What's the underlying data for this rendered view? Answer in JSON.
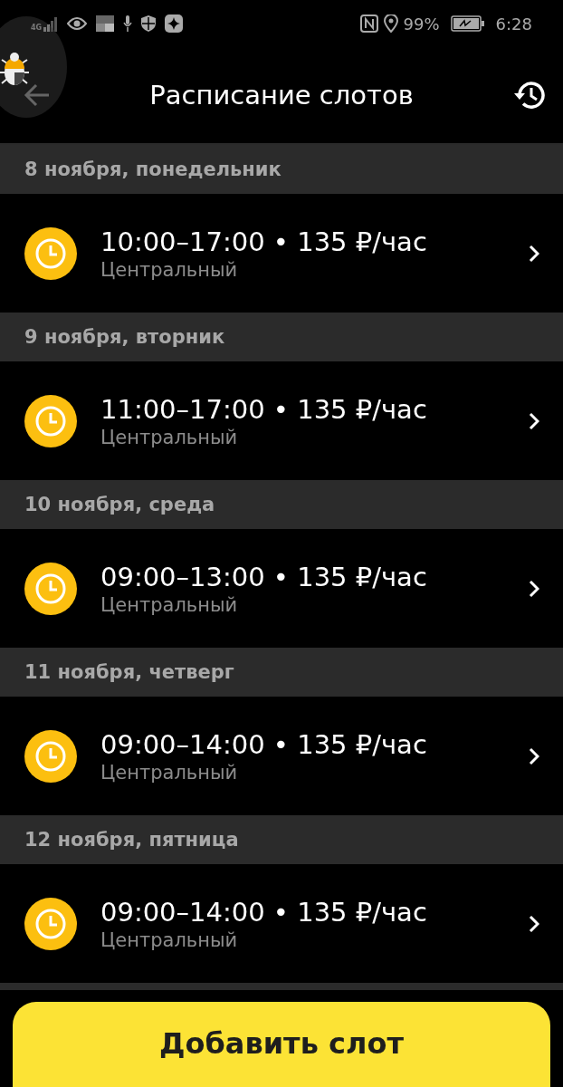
{
  "status_bar": {
    "network": "4G",
    "battery": "99%",
    "time": "6:28"
  },
  "header": {
    "title": "Расписание слотов"
  },
  "days": [
    {
      "date": "8 ноября, понедельник",
      "slots": [
        {
          "time": "10:00–17:00 • 135 ₽/час",
          "place": "Центральный"
        }
      ]
    },
    {
      "date": "9 ноября, вторник",
      "slots": [
        {
          "time": "11:00–17:00 • 135 ₽/час",
          "place": "Центральный"
        }
      ]
    },
    {
      "date": "10 ноября, среда",
      "slots": [
        {
          "time": "09:00–13:00 • 135 ₽/час",
          "place": "Центральный"
        }
      ]
    },
    {
      "date": "11 ноября, четверг",
      "slots": [
        {
          "time": "09:00–14:00 • 135 ₽/час",
          "place": "Центральный"
        }
      ]
    },
    {
      "date": "12 ноября, пятница",
      "slots": [
        {
          "time": "09:00–14:00 • 135 ₽/час",
          "place": "Центральный"
        }
      ]
    }
  ],
  "add_button": {
    "label": "Добавить слот"
  }
}
